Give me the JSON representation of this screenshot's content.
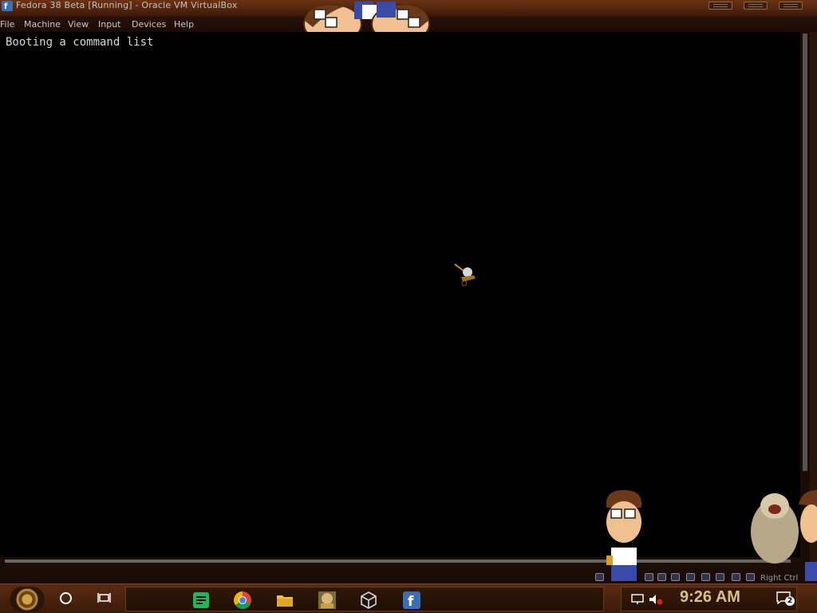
{
  "window": {
    "title": "Fedora 38 Beta [Running] - Oracle VM VirtualBox"
  },
  "menu": [
    {
      "label": "File"
    },
    {
      "label": "Machine"
    },
    {
      "label": "View"
    },
    {
      "label": "Input"
    },
    {
      "label": "Devices"
    },
    {
      "label": "Help"
    }
  ],
  "vm": {
    "console_text": "Booting a command list"
  },
  "status_bar": {
    "host_key": "Right Ctrl"
  },
  "taskbar": {
    "apps": [
      {
        "icon": "spotify-like-notes-icon"
      },
      {
        "icon": "chrome-icon"
      },
      {
        "icon": "file-explorer-icon"
      },
      {
        "icon": "virtualbox-box-icon"
      },
      {
        "icon": "virtualbox-cube-icon"
      },
      {
        "icon": "fedora-icon"
      }
    ],
    "clock": "9:26 AM",
    "notification_count": "2"
  },
  "colors": {
    "title_bg": "#5a2a10",
    "accent": "#d8c088",
    "screen": "#000000"
  }
}
